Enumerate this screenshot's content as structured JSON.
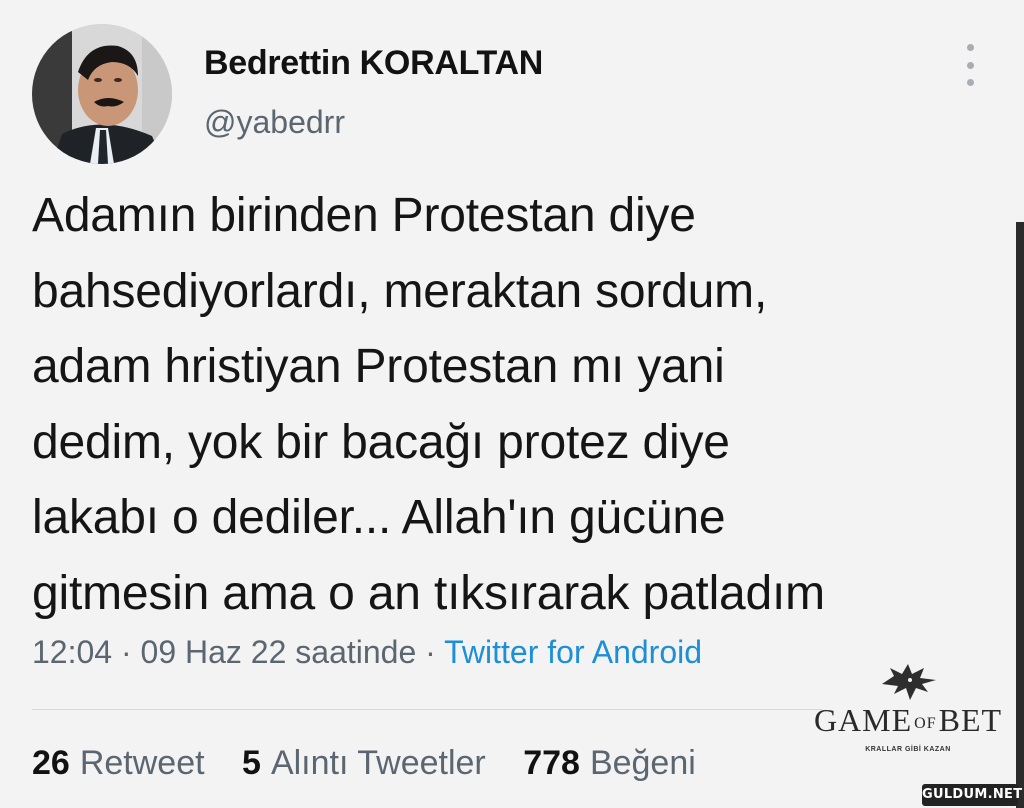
{
  "user": {
    "display_name": "Bedrettin KORALTAN",
    "handle": "@yabedrr"
  },
  "tweet": {
    "lines": [
      "Adamın birinden Protestan diye",
      "bahsediyorlardı, meraktan sordum,",
      "adam hristiyan Protestan mı yani",
      "dedim, yok bir bacağı protez diye",
      "lakabı o dediler... Allah'ın gücüne",
      "gitmesin ama o an tıksırarak patladım"
    ],
    "time": "12:04",
    "separator": "·",
    "date": "09 Haz 22 saatinde",
    "source": "Twitter for Android"
  },
  "stats": {
    "retweets": {
      "count": "26",
      "label": "Retweet"
    },
    "quotes": {
      "count": "5",
      "label": "Alıntı Tweetler"
    },
    "likes": {
      "count": "778",
      "label": "Beğeni"
    }
  },
  "watermark": {
    "logo_left": "GAME",
    "logo_of": "OF",
    "logo_right": "BET",
    "slogan": "KRALLAR GİBİ KAZAN",
    "site": "GULDUM.NET"
  },
  "colors": {
    "background": "#f3f3f4",
    "text": "#151515",
    "secondary": "#5b6670",
    "link": "#1d8fd6"
  },
  "icons": {
    "more": "more-vertical-icon",
    "watermark": "dragon-logo-icon"
  }
}
